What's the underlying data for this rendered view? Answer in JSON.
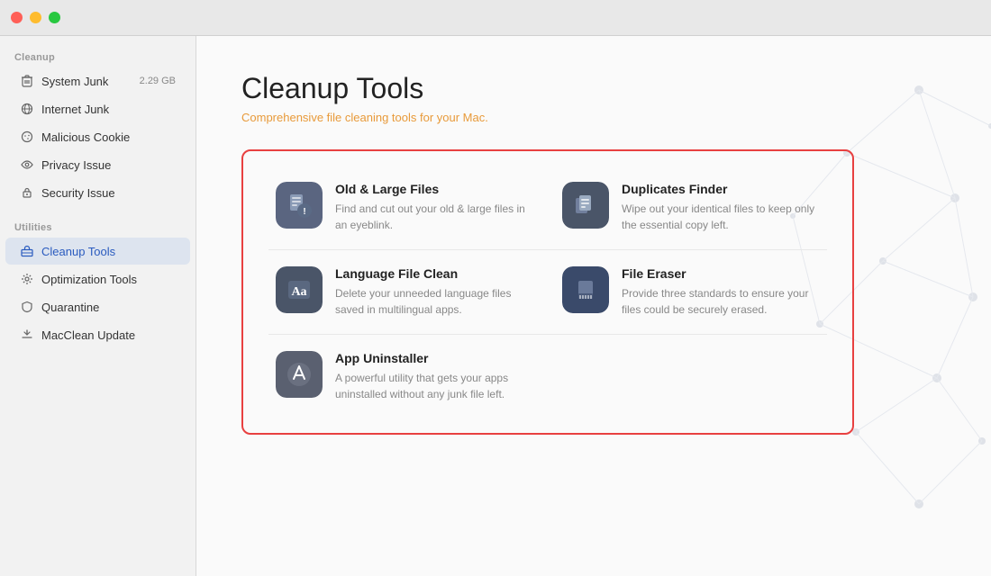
{
  "titlebar": {
    "close_label": "",
    "min_label": "",
    "max_label": ""
  },
  "sidebar": {
    "cleanup_section": "Cleanup",
    "utilities_section": "Utilities",
    "items_cleanup": [
      {
        "id": "system-junk",
        "label": "System Junk",
        "badge": "2.29 GB",
        "icon": "🗑"
      },
      {
        "id": "internet-junk",
        "label": "Internet Junk",
        "badge": "",
        "icon": "🌐"
      },
      {
        "id": "malicious-cookie",
        "label": "Malicious Cookie",
        "badge": "",
        "icon": "🍪"
      },
      {
        "id": "privacy-issue",
        "label": "Privacy Issue",
        "badge": "",
        "icon": "👁"
      },
      {
        "id": "security-issue",
        "label": "Security Issue",
        "badge": "",
        "icon": "🔒"
      }
    ],
    "items_utilities": [
      {
        "id": "cleanup-tools",
        "label": "Cleanup Tools",
        "badge": "",
        "icon": "🧰",
        "active": true
      },
      {
        "id": "optimization-tools",
        "label": "Optimization Tools",
        "badge": "",
        "icon": "⚙"
      },
      {
        "id": "quarantine",
        "label": "Quarantine",
        "badge": "",
        "icon": "🛡"
      },
      {
        "id": "macclean-update",
        "label": "MacClean Update",
        "badge": "",
        "icon": "↑"
      }
    ]
  },
  "main": {
    "title": "Cleanup Tools",
    "subtitle": "Comprehensive file cleaning tools for your Mac.",
    "tools": [
      {
        "id": "old-large-files",
        "title": "Old & Large Files",
        "desc": "Find and cut out your old & large files in an eyeblink.",
        "icon_type": "old-files"
      },
      {
        "id": "duplicates-finder",
        "title": "Duplicates Finder",
        "desc": "Wipe out your identical files to keep only the essential copy left.",
        "icon_type": "duplicates"
      },
      {
        "id": "language-file-clean",
        "title": "Language File Clean",
        "desc": "Delete your unneeded language files saved in multilingual apps.",
        "icon_type": "language"
      },
      {
        "id": "file-eraser",
        "title": "File Eraser",
        "desc": "Provide three standards to ensure your files could be securely erased.",
        "icon_type": "eraser"
      },
      {
        "id": "app-uninstaller",
        "title": "App Uninstaller",
        "desc": "A powerful utility that gets your apps uninstalled without any junk file left.",
        "icon_type": "uninstaller"
      }
    ]
  }
}
